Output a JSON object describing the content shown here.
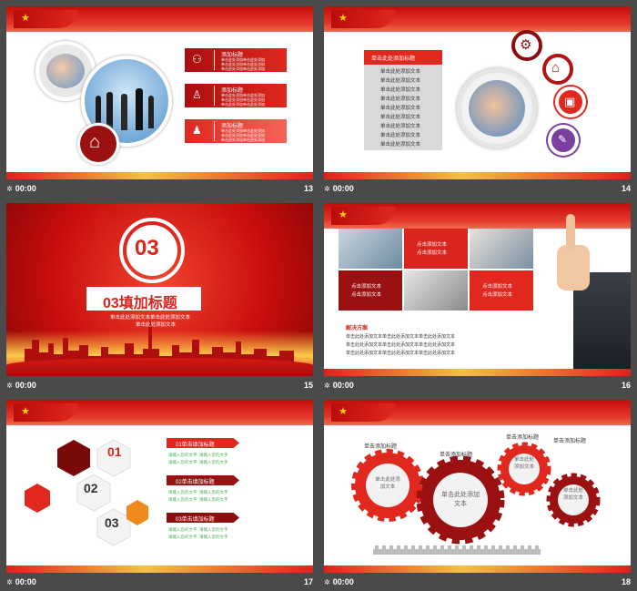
{
  "slides": [
    {
      "time": "00:00",
      "num": "13",
      "items": [
        {
          "title": "添加标题",
          "lines": [
            "单击此处添加单击此处添加",
            "单击此处添加单击此处添加",
            "单击此处添加单击此处添加"
          ]
        },
        {
          "title": "添加标题",
          "lines": [
            "单击此处添加单击此处添加",
            "单击此处添加单击此处添加",
            "单击此处添加单击此处添加"
          ]
        },
        {
          "title": "添加标题",
          "lines": [
            "单击此处添加单击此处添加",
            "单击此处添加单击此处添加",
            "单击此处添加单击此处添加"
          ]
        }
      ]
    },
    {
      "time": "00:00",
      "num": "14",
      "box_title": "单击此处添加标题",
      "box_lines": [
        "单击此处添加文本",
        "单击此处添加文本",
        "单击此处添加文本",
        "单击此处添加文本",
        "单击此处添加文本",
        "单击此处添加文本",
        "单击此处添加文本",
        "单击此处添加文本",
        "单击此处添加文本"
      ]
    },
    {
      "time": "00:00",
      "num": "15",
      "big_num": "03",
      "title": "03填加标题",
      "sub1": "单击此处添加文本单击此处添加文本",
      "sub2": "单击此处添加文本"
    },
    {
      "time": "00:00",
      "num": "16",
      "cells": [
        "点击添加文本",
        "点击添加文本",
        "点击添加文本",
        "点击添加文本",
        "点击添加文本",
        "点击添加文本"
      ],
      "section": "解决方案",
      "rows": [
        "单击此处添加文本单击此处添加文本单击此处添加文本",
        "单击此处添加文本单击此处添加文本单击此处添加文本",
        "单击此处添加文本单击此处添加文本单击此处添加文本"
      ]
    },
    {
      "time": "00:00",
      "num": "17",
      "hex": [
        "01",
        "02",
        "03"
      ],
      "sections": [
        {
          "title": "01单击填加标题",
          "lines": [
            "请输入您的文字",
            "请输入您的文字",
            "请输入您的文字",
            "请输入您的文字"
          ]
        },
        {
          "title": "02单击填加标题",
          "lines": [
            "请输入您的文字",
            "请输入您的文字",
            "请输入您的文字",
            "请输入您的文字"
          ]
        },
        {
          "title": "03单击填加标题",
          "lines": [
            "请输入您的文字",
            "请输入您的文字",
            "请输入您的文字",
            "请输入您的文字"
          ]
        }
      ]
    },
    {
      "time": "00:00",
      "num": "18",
      "labels": [
        "单击添加标题",
        "单击添加标题",
        "单击添加标题",
        "单击添加标题"
      ],
      "gear_texts": [
        "单击此处添加文本",
        "单击此处添加文本",
        "单击此处添加文本",
        "单击此处添加文本"
      ]
    }
  ],
  "colors": {
    "red": "#d9251b",
    "darkred": "#8c0d0d",
    "gold": "#ffd200",
    "bg": "#4a4a4a"
  }
}
